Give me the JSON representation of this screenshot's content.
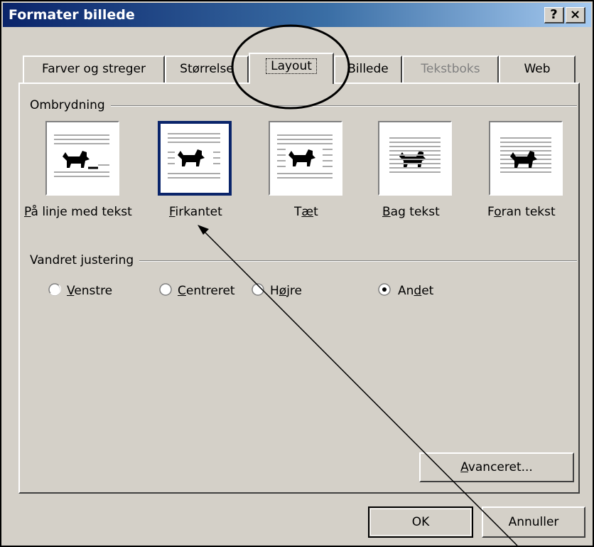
{
  "window": {
    "title": "Formater billede",
    "help_button": "?",
    "close_button": "×"
  },
  "tabs": [
    {
      "label": "Farver og streger"
    },
    {
      "label": "Størrelse"
    },
    {
      "label": "Layout"
    },
    {
      "label": "Billede"
    },
    {
      "label": "Tekstboks"
    },
    {
      "label": "Web"
    }
  ],
  "active_tab": "Layout",
  "wrapping": {
    "group_label": "Ombrydning",
    "options": [
      {
        "label_u": "P",
        "label_rest": "å linje med tekst"
      },
      {
        "label_u": "F",
        "label_rest": "irkantet"
      },
      {
        "label_pre": "T",
        "label_u": "æ",
        "label_rest": "t"
      },
      {
        "label_u": "B",
        "label_rest": "ag tekst"
      },
      {
        "label_pre": "F",
        "label_u": "o",
        "label_rest": "ran tekst"
      }
    ],
    "selected": "Firkantet"
  },
  "alignment": {
    "group_label": "Vandret justering",
    "options": [
      {
        "label_u": "V",
        "label_rest": "enstre"
      },
      {
        "label_u": "C",
        "label_rest": "entreret"
      },
      {
        "label_pre": "H",
        "label_u": "ø",
        "label_rest": "jre"
      },
      {
        "label_pre": "An",
        "label_u": "d",
        "label_rest": "et"
      }
    ],
    "selected": "Andet"
  },
  "buttons": {
    "advanced_u": "A",
    "advanced_rest": "vanceret...",
    "ok": "OK",
    "cancel": "Annuller"
  },
  "colors": {
    "dialog_bg": "#d4d0c8",
    "title_start": "#0a246a",
    "title_end": "#a6caf0",
    "selection": "#0a246a"
  }
}
